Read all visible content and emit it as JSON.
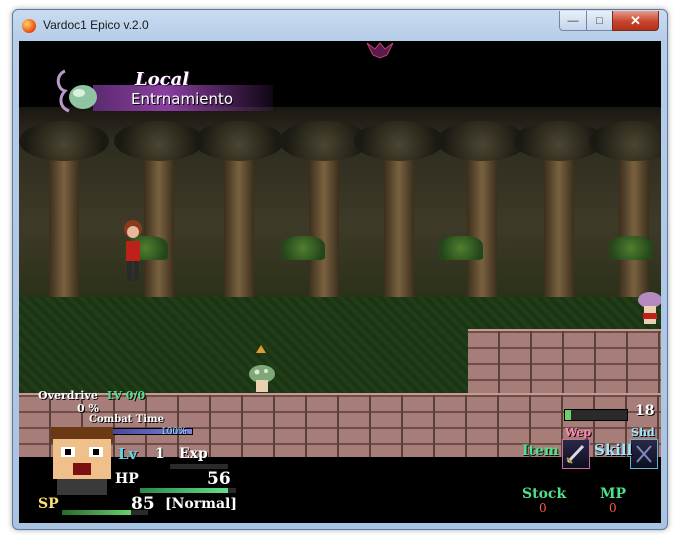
{
  "window": {
    "title": "Vardoc1 Epico v.2.0"
  },
  "banner": {
    "title": "Local",
    "subtitle": "Entrnamiento"
  },
  "hud": {
    "overdrive_label": "Overdrive",
    "overdrive_lv": "LV 0/0",
    "overdrive_percent": "0 %",
    "combat_time_label": "Combat Time",
    "combat_time_value": "100%",
    "lv_label": "Lv",
    "lv_value": "1",
    "exp_label": "Exp",
    "hp_label": "HP",
    "hp_value": "56",
    "sp_label": "SP",
    "sp_value": "85",
    "status": "[Normal]",
    "count_value": "18",
    "wep_label": "Wep",
    "shd_label": "Shd",
    "item_label": "Item",
    "skill_label": "Skill",
    "stock_label": "Stock",
    "stock_value": "0",
    "mp_label": "MP",
    "mp_value": "0",
    "hp_fill": 0.92,
    "sp_fill": 0.8,
    "combat_fill": 1.0
  },
  "colors": {
    "hud_green": "#4fe08a",
    "lv_cyan": "#5fd6e6",
    "stock_red": "#ff5a4a",
    "banner_purple": "#8a3fa0"
  }
}
